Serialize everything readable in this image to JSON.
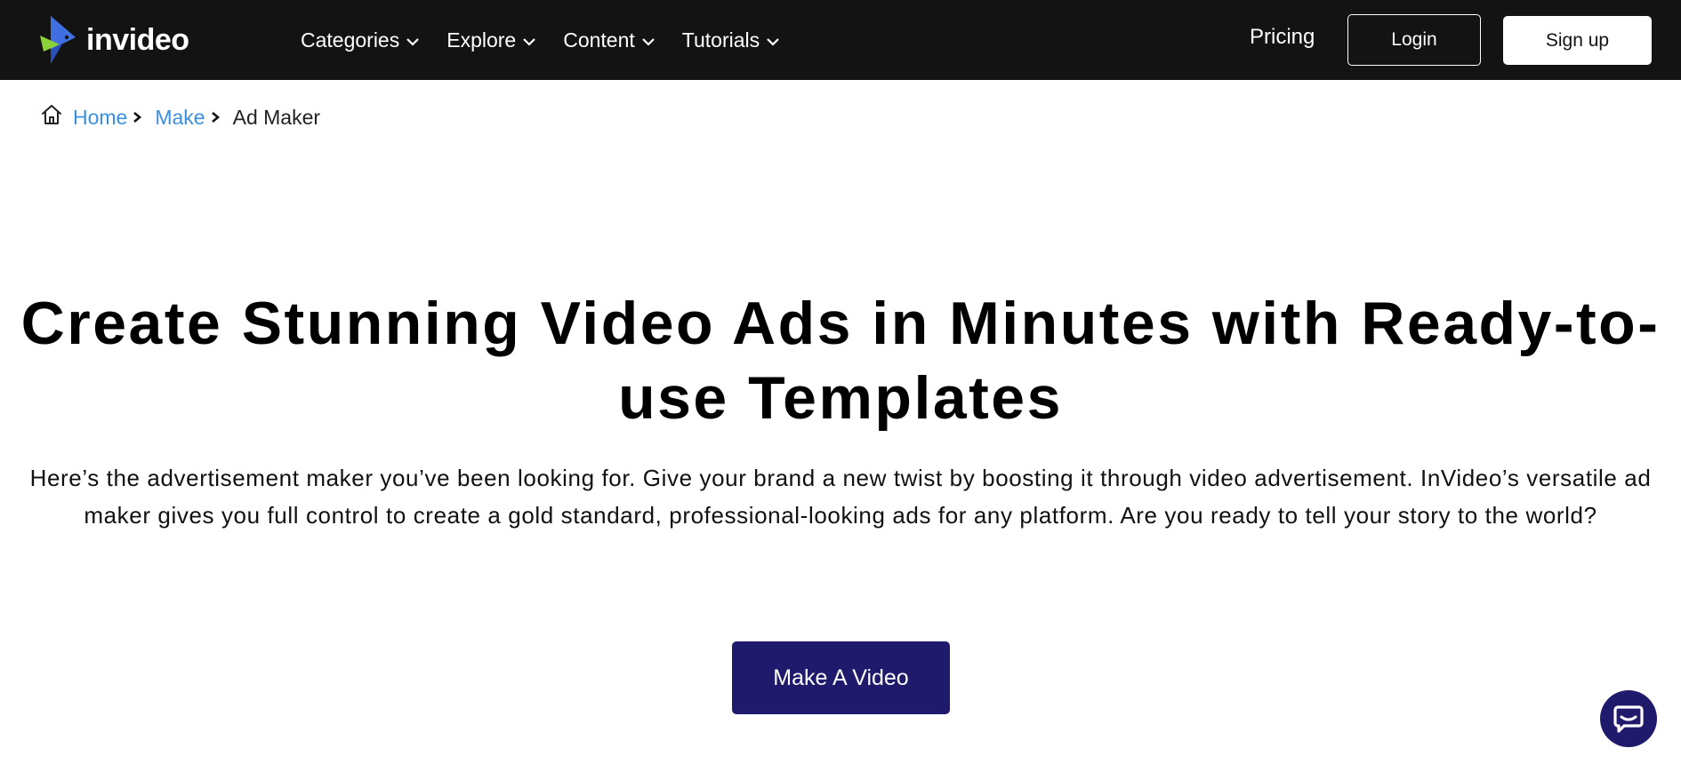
{
  "brand": {
    "logo_text": "invideo",
    "colors": {
      "nav_bg": "#131313",
      "link_blue": "#3a8fdd",
      "cta_bg": "#201a6d",
      "logo_blue": "#3f6fe0",
      "logo_green": "#8bd13a"
    }
  },
  "nav": {
    "menu": [
      {
        "label": "Categories",
        "icon": "chevron-down-icon"
      },
      {
        "label": "Explore",
        "icon": "chevron-down-icon"
      },
      {
        "label": "Content",
        "icon": "chevron-down-icon"
      },
      {
        "label": "Tutorials",
        "icon": "chevron-down-icon"
      }
    ],
    "pricing_label": "Pricing",
    "login_label": "Login",
    "signup_label": "Sign up"
  },
  "breadcrumb": {
    "icon": "home-icon",
    "items": [
      {
        "label": "Home"
      },
      {
        "label": "Make"
      },
      {
        "label": "Ad Maker"
      }
    ]
  },
  "hero": {
    "title": "Create Stunning Video Ads in Minutes with Ready-to-use Templates",
    "description": "Here’s the advertisement maker you’ve been looking for. Give your brand a new twist by boosting it through video advertisement. InVideo’s versatile ad maker gives you full control to create a gold standard, professional-looking ads for any platform. Are you ready to tell your story to the world?",
    "cta_label": "Make A Video"
  },
  "chat": {
    "icon": "chat-icon"
  }
}
